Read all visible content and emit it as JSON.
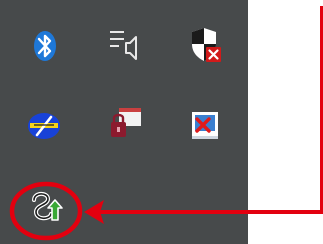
{
  "tray": {
    "icons": [
      {
        "id": "bluetooth",
        "name": "bluetooth-icon"
      },
      {
        "id": "volume",
        "name": "volume-muted-icon"
      },
      {
        "id": "defender",
        "name": "windows-security-alert-icon"
      },
      {
        "id": "network",
        "name": "network-icon"
      },
      {
        "id": "vpn",
        "name": "vpn-lock-icon"
      },
      {
        "id": "display",
        "name": "display-error-icon"
      },
      {
        "id": "app",
        "name": "sync-up-arrow-icon"
      }
    ]
  },
  "annotation": {
    "highlight_color": "#e3000f",
    "highlighted_icon": "sync-up-arrow-icon"
  },
  "colors": {
    "tray_background": "#474a4b",
    "bluetooth_blue": "#1e78d8",
    "network_blue": "#1842d8",
    "network_yellow": "#f5d21a",
    "alert_red": "#d11a1a",
    "arrow_green": "#3aa835"
  }
}
